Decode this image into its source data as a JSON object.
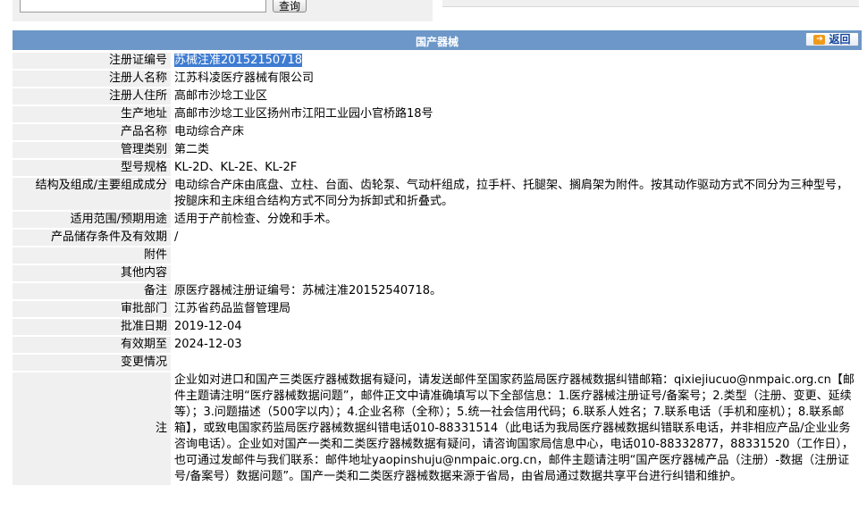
{
  "search": {
    "value": "",
    "button_label": "查询"
  },
  "section": {
    "title": "国产器械",
    "back_label": "返回"
  },
  "fields": [
    {
      "label": "注册证编号",
      "value": "苏械注准20152150718"
    },
    {
      "label": "注册人名称",
      "value": "江苏科凌医疗器械有限公司"
    },
    {
      "label": "注册人住所",
      "value": "高邮市沙埝工业区"
    },
    {
      "label": "生产地址",
      "value": "高邮市沙埝工业区扬州市江阳工业园小官桥路18号"
    },
    {
      "label": "产品名称",
      "value": "电动综合产床"
    },
    {
      "label": "管理类别",
      "value": "第二类"
    },
    {
      "label": "型号规格",
      "value": "KL-2D、KL-2E、KL-2F"
    },
    {
      "label": "结构及组成/主要组成成分",
      "value": "电动综合产床由底盘、立柱、台面、齿轮泵、气动杆组成，拉手杆、托腿架、搁肩架为附件。按其动作驱动方式不同分为三种型号，按腿床和主床组合结构方式不同分为拆卸式和折叠式。"
    },
    {
      "label": "适用范围/预期用途",
      "value": "适用于产前检查、分娩和手术。"
    },
    {
      "label": "产品储存条件及有效期",
      "value": "/"
    },
    {
      "label": "附件",
      "value": ""
    },
    {
      "label": "其他内容",
      "value": ""
    },
    {
      "label": "备注",
      "value": "原医疗器械注册证编号：苏械注准20152540718。"
    },
    {
      "label": "审批部门",
      "value": "江苏省药品监督管理局"
    },
    {
      "label": "批准日期",
      "value": "2019-12-04"
    },
    {
      "label": "有效期至",
      "value": "2024-12-03"
    },
    {
      "label": "变更情况",
      "value": ""
    }
  ],
  "notice": {
    "label": "注",
    "text": "企业如对进口和国产三类医疗器械数据有疑问，请发送邮件至国家药监局医疗器械数据纠错邮箱：qixiejiucuo@nmpaic.org.cn【邮件主题请注明“医疗器械数据问题”，邮件正文中请准确填写以下全部信息：1.医疗器械注册证号/备案号；2.类型（注册、变更、延续等）；3.问题描述（500字以内）；4.企业名称（全称）；5.统一社会信用代码；6.联系人姓名；7.联系电话（手机和座机）；8.联系邮箱】，或致电国家药监局医疗器械数据纠错电话010-88331514（此电话为我局医疗器械数据纠错联系电话，并非相应产品/企业业务咨询电话）。企业如对国产一类和二类医疗器械数据有疑问，请咨询国家局信息中心，电话010-88332877，88331520（工作日），也可通过发邮件与我们联系：邮件地址yaopinshuju@nmpaic.org.cn，邮件主题请注明“国产医疗器械产品（注册）-数据（注册证号/备案号）数据问题”。国产一类和二类医疗器械数据来源于省局，由省局通过数据共享平台进行纠错和维护。"
  }
}
